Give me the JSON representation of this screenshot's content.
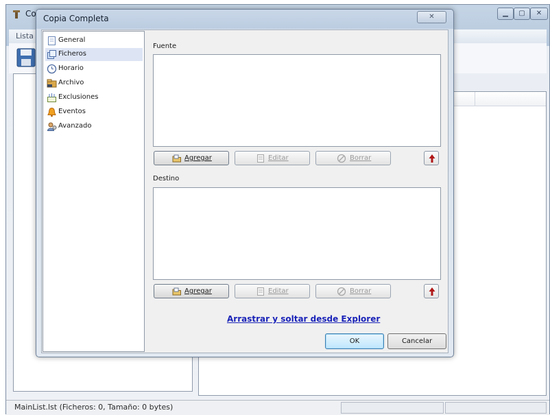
{
  "main_window": {
    "title": "Co",
    "menu_first": "Lista",
    "status_text": "MainList.lst (Ficheros: 0, Tamaño: 0 bytes)"
  },
  "dialog": {
    "title": "Copia Completa",
    "nav": [
      {
        "label": "General",
        "icon": "document-icon"
      },
      {
        "label": "Ficheros",
        "icon": "files-icon",
        "selected": true
      },
      {
        "label": "Horario",
        "icon": "clock-icon"
      },
      {
        "label": "Archivo",
        "icon": "archive-icon"
      },
      {
        "label": "Exclusiones",
        "icon": "exclusions-icon"
      },
      {
        "label": "Eventos",
        "icon": "bell-icon"
      },
      {
        "label": "Avanzado",
        "icon": "advanced-icon"
      }
    ],
    "source": {
      "label": "Fuente",
      "add": "Agregar",
      "edit": "Editar",
      "delete": "Borrar"
    },
    "destination": {
      "label": "Destino",
      "add": "Agregar",
      "edit": "Editar",
      "delete": "Borrar"
    },
    "drag_link": "Arrastrar y soltar desde Explorer",
    "ok": "OK",
    "cancel": "Cancelar"
  },
  "colors": {
    "link": "#1b24b8",
    "up_arrow": "#b01818",
    "nav_selected": "#dde5f5"
  }
}
